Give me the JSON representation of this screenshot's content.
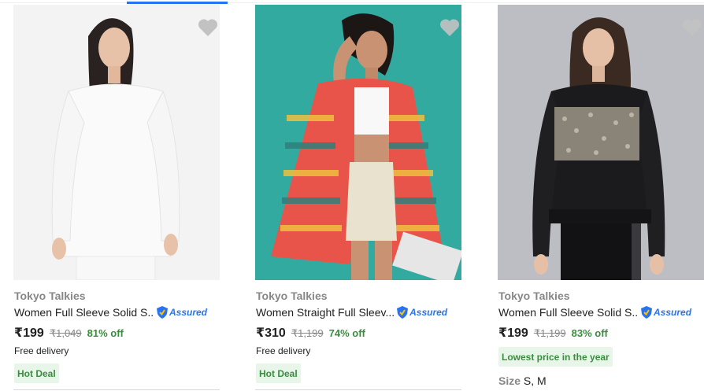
{
  "products": [
    {
      "brand": "Tokyo Talkies",
      "title": "Women Full Sleeve Solid S...",
      "assured_label": "Assured",
      "price": "₹199",
      "mrp": "₹1,049",
      "discount": "81% off",
      "delivery": "Free delivery",
      "badge": "Hot Deal",
      "image_colors": {
        "bg": "#f3f3f3",
        "garment": "#fafafa"
      }
    },
    {
      "brand": "Tokyo Talkies",
      "title": "Women Straight Full Sleev...",
      "assured_label": "Assured",
      "price": "₹310",
      "mrp": "₹1,199",
      "discount": "74% off",
      "delivery": "Free delivery",
      "badge": "Hot Deal",
      "image_colors": {
        "bg": "#33aaa0",
        "garment": "#e8544a"
      }
    },
    {
      "brand": "Tokyo Talkies",
      "title": "Women Full Sleeve Solid S...",
      "assured_label": "Assured",
      "price": "₹199",
      "mrp": "₹1,199",
      "discount": "83% off",
      "badge": "Lowest price in the year",
      "size_label": "Size",
      "sizes": "S, M",
      "image_colors": {
        "bg": "#bdbdc4",
        "garment": "#1b1b1d"
      }
    }
  ],
  "colors": {
    "accent": "#2874f0",
    "discount_green": "#388e3c",
    "muted_text": "#878787",
    "wishlist_gray": "#c2c2c2"
  },
  "icons": {
    "wishlist": "heart-icon",
    "assured": "assured-shield-icon"
  }
}
